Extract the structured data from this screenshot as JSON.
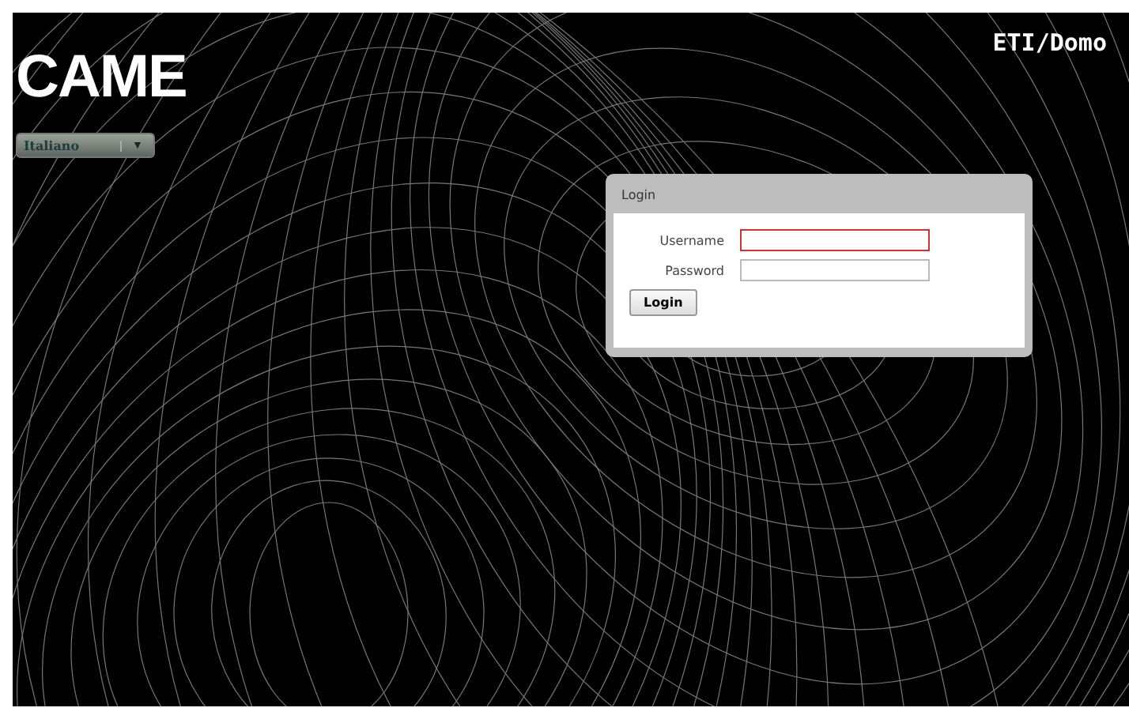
{
  "header": {
    "logo": "CAME",
    "product": "ETI/Domo"
  },
  "language_select": {
    "value": "Italiano",
    "caret": "▼"
  },
  "login_panel": {
    "title": "Login",
    "fields": [
      {
        "label": "Username",
        "focused": true
      },
      {
        "label": "Password",
        "focused": false
      }
    ],
    "button": "Login"
  }
}
